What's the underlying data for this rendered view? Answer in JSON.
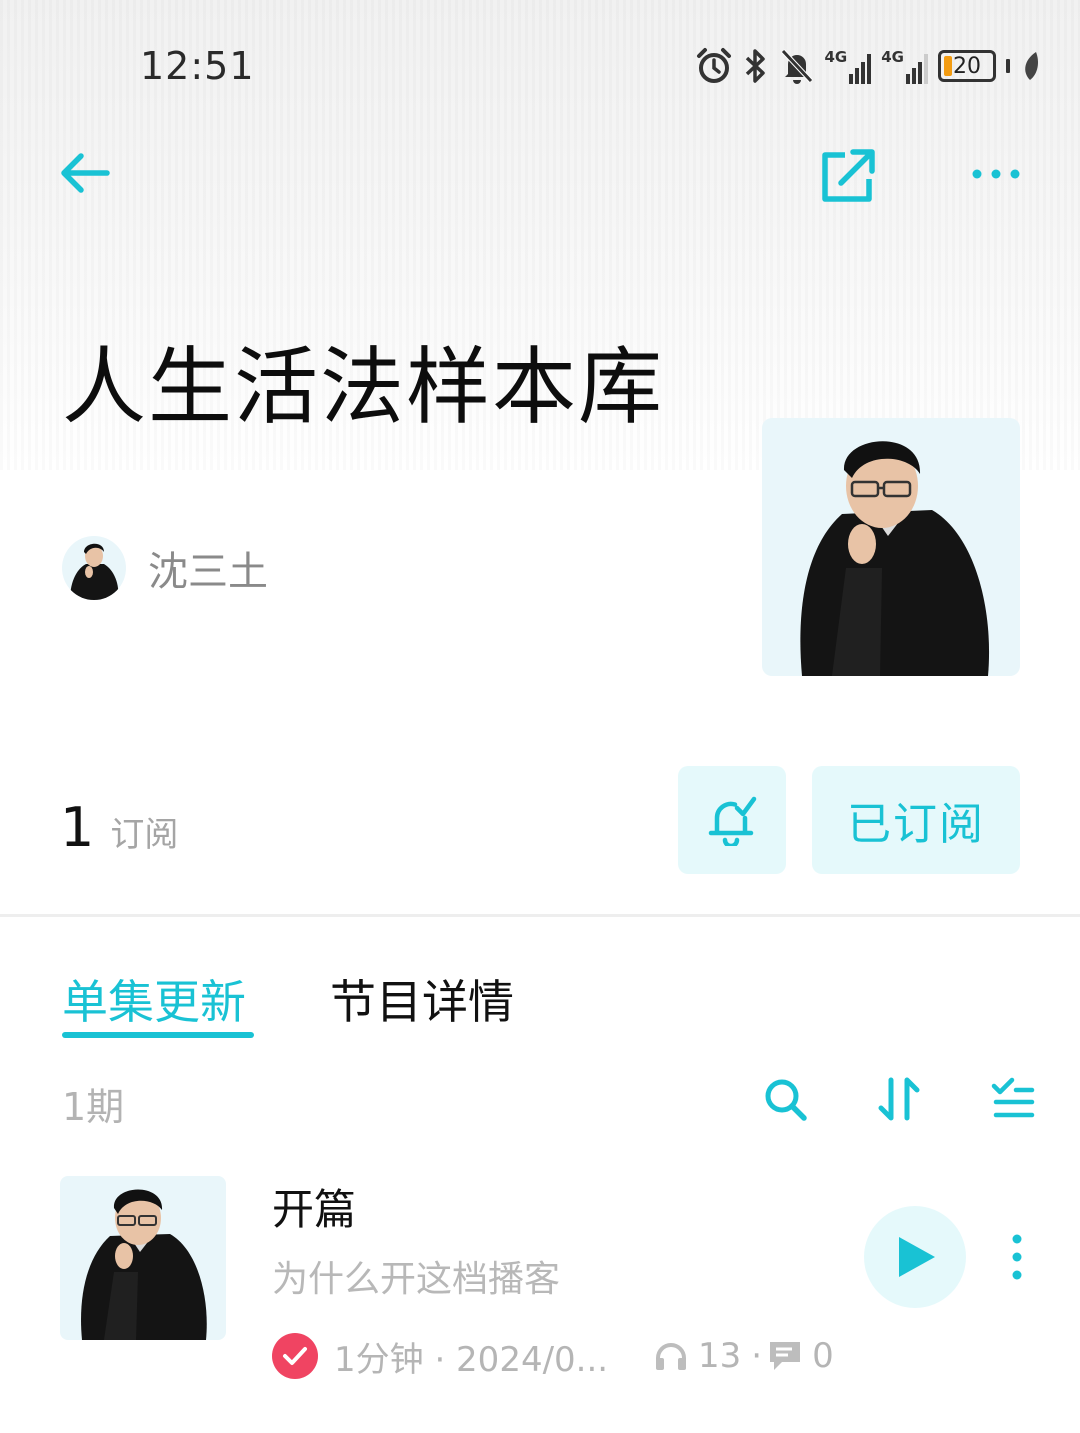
{
  "status_bar": {
    "time": "12:51",
    "network_1": "4G",
    "network_2": "4G",
    "battery": "20"
  },
  "nav": {
    "back_icon": "arrow-left-icon",
    "share_icon": "share-external-icon",
    "more_icon": "more-horizontal-icon"
  },
  "podcast": {
    "title": "人生活法样本库",
    "author": "沈三土",
    "subscriber_count": "1",
    "subscriber_label": "订阅",
    "subscribed_label": "已订阅"
  },
  "tabs": [
    {
      "label": "单集更新",
      "active": true
    },
    {
      "label": "节目详情",
      "active": false
    }
  ],
  "episodes_header": {
    "count": "1期"
  },
  "episodes": [
    {
      "title": "开篇",
      "description": "为什么开这档播客",
      "meta": "1分钟 · 2024/0...",
      "plays": "13",
      "separator": "·",
      "comments": "0"
    }
  ],
  "colors": {
    "accent": "#19c2d4",
    "accent_bg": "#e5f9fb",
    "played": "#f04462"
  }
}
